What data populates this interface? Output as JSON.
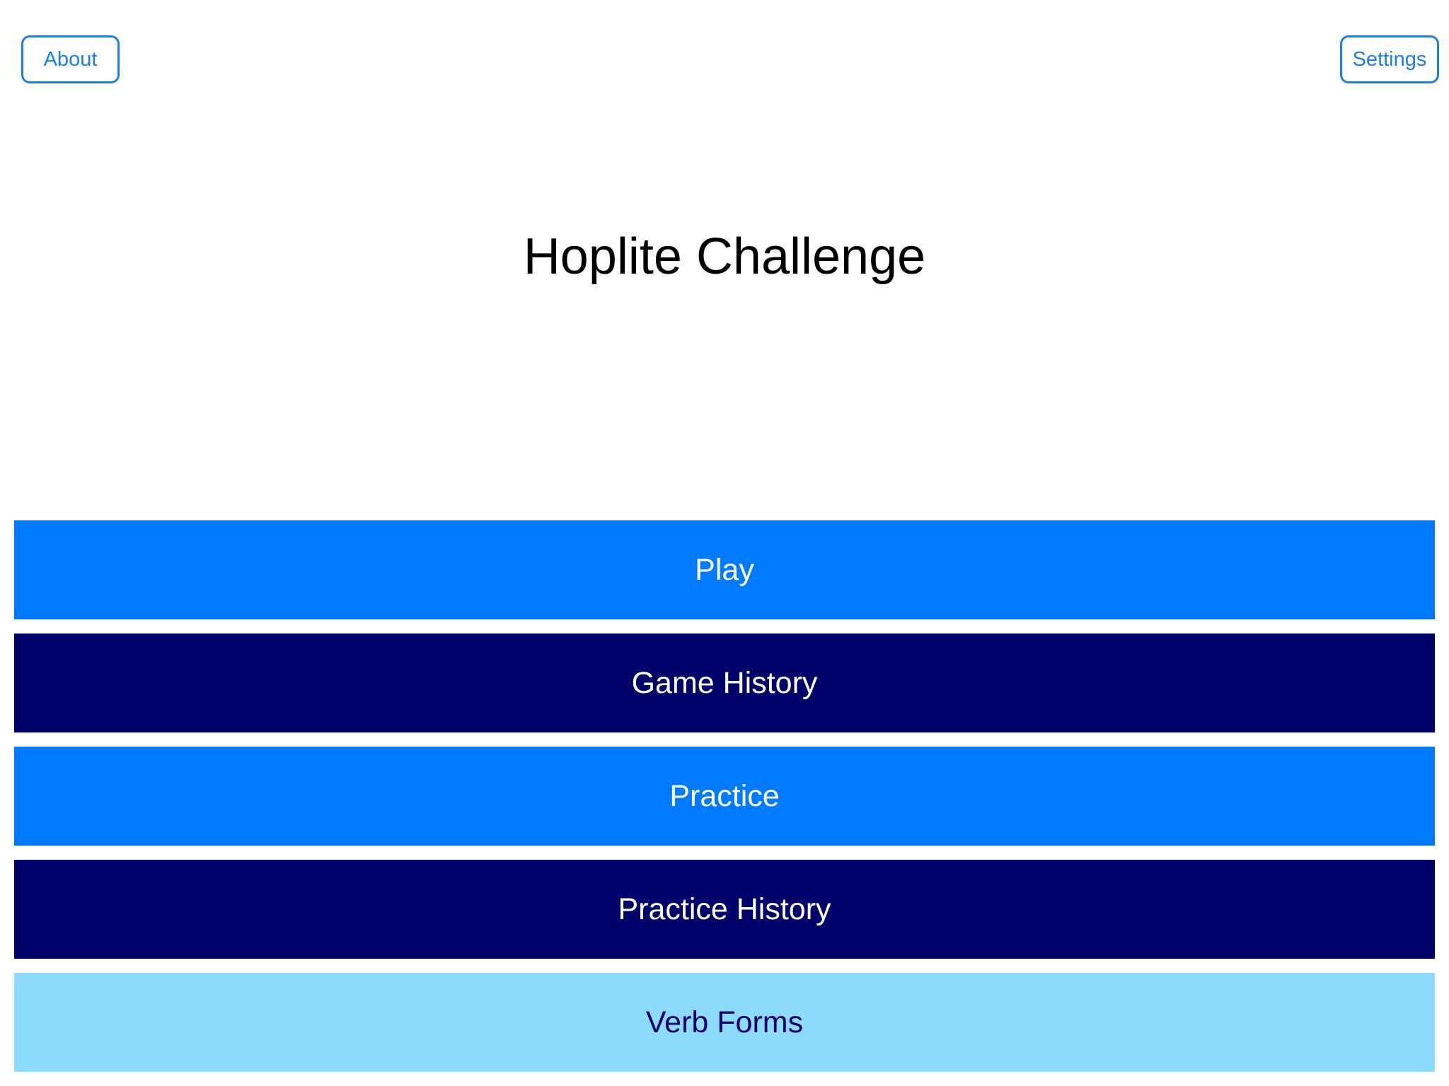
{
  "header": {
    "about_label": "About",
    "settings_label": "Settings"
  },
  "title": "Hoplite Challenge",
  "colors": {
    "accent": "#1a7fe8",
    "primary_blue": "#007aff",
    "navy": "#00006b",
    "light_blue": "#8cdbfc"
  },
  "menu": {
    "items": [
      {
        "label": "Play",
        "bg": "#007aff",
        "fg": "#ffffff"
      },
      {
        "label": "Game History",
        "bg": "#00006b",
        "fg": "#ffffff"
      },
      {
        "label": "Practice",
        "bg": "#007aff",
        "fg": "#ffffff"
      },
      {
        "label": "Practice History",
        "bg": "#00006b",
        "fg": "#ffffff"
      },
      {
        "label": "Verb Forms",
        "bg": "#8cdbfc",
        "fg": "#00006b"
      }
    ]
  }
}
